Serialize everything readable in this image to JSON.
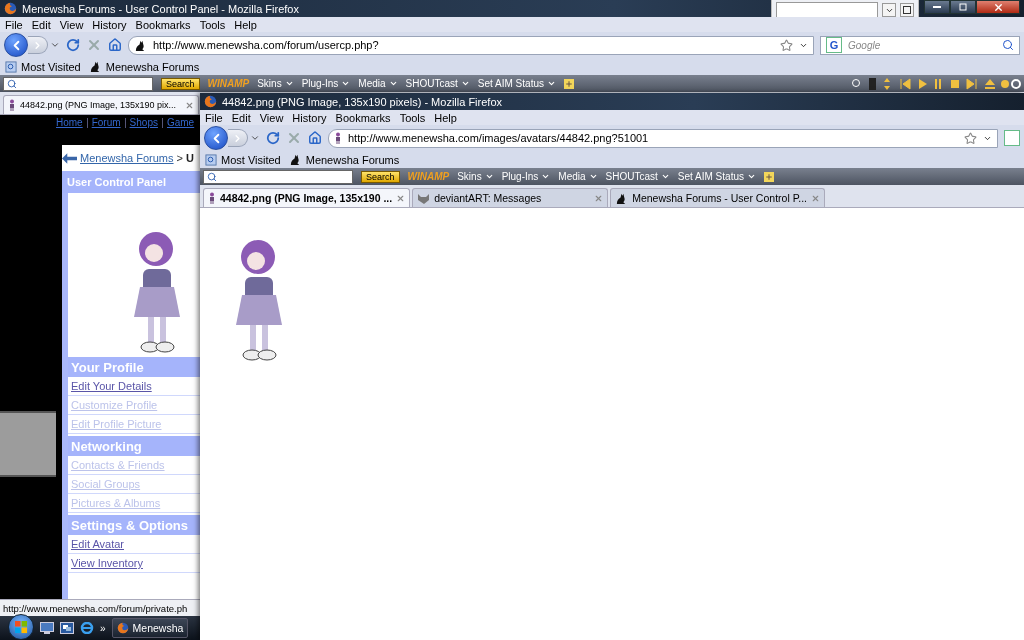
{
  "back_window": {
    "title": "Menewsha Forums - User Control Panel - Mozilla Firefox",
    "menu": [
      "File",
      "Edit",
      "View",
      "History",
      "Bookmarks",
      "Tools",
      "Help"
    ],
    "address": "http://www.menewsha.com/forum/usercp.php?",
    "search_engine": "G",
    "search_placeholder": "Google",
    "bookmarks": [
      "Most Visited",
      "Menewsha Forums"
    ],
    "toolbar": {
      "search_button": "Search",
      "logo": "WINAMP",
      "menus": [
        "Skins",
        "Plug-Ins",
        "Media",
        "SHOUTcast",
        "Set AIM Status"
      ]
    },
    "tabs": [
      {
        "label": "44842.png (PNG Image, 135x190 pix...",
        "selected": true
      }
    ],
    "page": {
      "top_links": [
        "Home",
        "Forum",
        "Shops",
        "Game"
      ],
      "breadcrumb": {
        "link": "Menewsha Forums",
        "separator": ">",
        "current": "U"
      },
      "panel_title": "User Control Panel",
      "sections": [
        {
          "title": "Your Profile",
          "links": [
            {
              "label": "Edit Your Details",
              "visited": true
            },
            {
              "label": "Customize Profile",
              "visited": false
            },
            {
              "label": "Edit Profile Picture",
              "visited": false
            }
          ]
        },
        {
          "title": "Networking",
          "links": [
            {
              "label": "Contacts & Friends",
              "visited": false
            },
            {
              "label": "Social Groups",
              "visited": false
            },
            {
              "label": "Pictures & Albums",
              "visited": false
            }
          ]
        },
        {
          "title": "Settings & Options",
          "links": [
            {
              "label": "Edit Avatar",
              "visited": true
            },
            {
              "label": "View Inventory",
              "visited": true
            }
          ]
        }
      ]
    },
    "status_bar": "http://www.menewsha.com/forum/private.ph"
  },
  "front_window": {
    "title": "44842.png (PNG Image, 135x190 pixels) - Mozilla Firefox",
    "menu": [
      "File",
      "Edit",
      "View",
      "History",
      "Bookmarks",
      "Tools",
      "Help"
    ],
    "address": "http://www.menewsha.com/images/avatars/44842.png?51001",
    "bookmarks": [
      "Most Visited",
      "Menewsha Forums"
    ],
    "toolbar": {
      "search_button": "Search",
      "logo": "WINAMP",
      "menus": [
        "Skins",
        "Plug-Ins",
        "Media",
        "SHOUTcast",
        "Set AIM Status"
      ]
    },
    "tabs": [
      {
        "label": "44842.png (PNG Image, 135x190 ...",
        "selected": true
      },
      {
        "label": "deviantART: Messages",
        "selected": false
      },
      {
        "label": "Menewsha Forums - User Control P...",
        "selected": false
      }
    ]
  },
  "taskbar": {
    "more": "»",
    "buttons": [
      "Menewsha"
    ]
  }
}
